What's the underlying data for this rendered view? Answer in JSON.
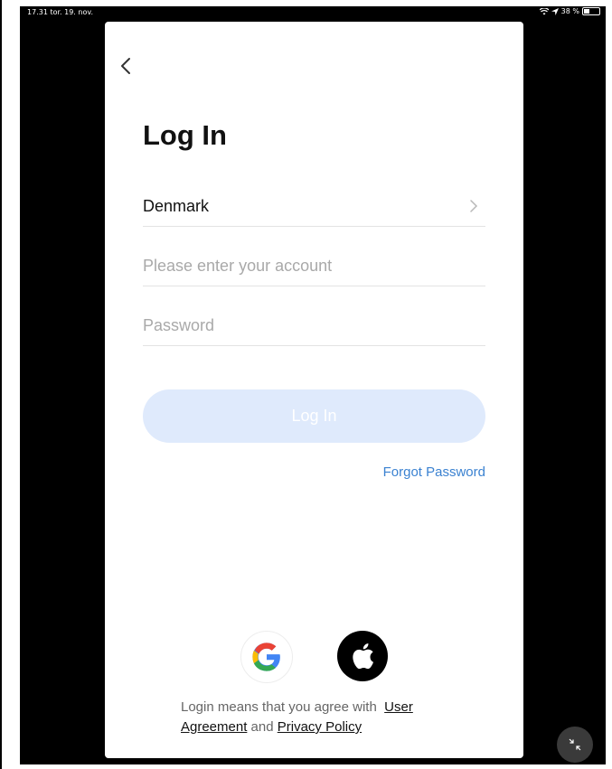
{
  "status_bar": {
    "time": "17.31",
    "date": "tor. 19. nov.",
    "battery": "38 %"
  },
  "login": {
    "title": "Log In",
    "country": "Denmark",
    "account_placeholder": "Please enter your account",
    "password_placeholder": "Password",
    "login_button": "Log In",
    "forgot_password": "Forgot Password"
  },
  "terms": {
    "prefix": "Login means that you agree with",
    "user_agreement": "User Agreement",
    "and": "and",
    "privacy_policy": "Privacy Policy"
  },
  "social": {
    "google": "google-icon",
    "apple": "apple-icon"
  },
  "colors": {
    "accent": "#3b82d1",
    "button_disabled": "#dfeafc"
  }
}
